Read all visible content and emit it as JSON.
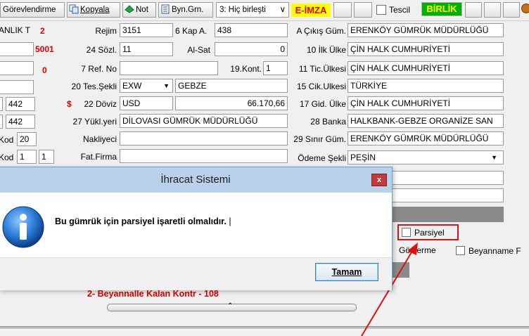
{
  "toolbar": {
    "gorevlendirme": "Görevlendirme",
    "kopyala": "Kopyala",
    "not": "Not",
    "byn_grn": "Byn.Grn.",
    "birlesti_select": "3: Hiç birleşti",
    "eimza": "E-İMZA",
    "tescil": "Tescil",
    "birlik": "BİRLİK"
  },
  "left_partial": {
    "r1": "ANLIK T",
    "r1_num": "2",
    "r2_num": "5001",
    "r3_num": "0",
    "r5_val": "442",
    "r6_val": "442",
    "r7_label": "Kod",
    "r7_val": "20",
    "r8_label": "Kod",
    "r8_val1": "1",
    "r8_val2": "1"
  },
  "form": {
    "rejim_label": "Rejim",
    "rejim": "3151",
    "kap_label": "6 Kap A.",
    "kap": "438",
    "sozl_label": "24 Sözl.",
    "sozl": "11",
    "alsat_label": "Al-Sat",
    "alsat": "0",
    "refno_label": "7 Ref. No",
    "refno": "",
    "kont_label": "19.Kont.",
    "kont": "1",
    "tesekli_label": "20 Tes.Şekli",
    "tesekli": "EXW",
    "tes_place": "GEBZE",
    "doviz_symbol": "$",
    "doviz_label": "22 Döviz",
    "doviz": "USD",
    "doviz_amount": "66.170,66",
    "yukl_label": "27 Yükl.yeri",
    "yukl": "DİLOVASI GÜMRÜK MÜDÜRLÜĞÜ",
    "nakliyeci_label": "Nakliyeci",
    "nakliyeci": "",
    "fatfirma_label": "Fat.Firma",
    "fatfirma": "",
    "cikis_label": "A Çıkış Güm.",
    "cikis": "ERENKÖY GÜMRÜK MÜDÜRLÜĞÜ",
    "ilkulke_label": "10 İlk Ülke",
    "ilkulke": "ÇİN HALK CUMHURİYETİ",
    "ticulke_label": "11 Tic.Ülkesi",
    "ticulke": "ÇİN HALK CUMHURİYETİ",
    "cikulke_label": "15 Cik.Ulkesi",
    "cikulke": "TÜRKİYE",
    "gidulke_label": "17 Gid. Ülke",
    "gidulke": "ÇİN HALK CUMHURİYETİ",
    "banka_label": "28 Banka",
    "banka": "HALKBANK-GEBZE ORGANİZE SAN",
    "sinir_label": "29 Sınır Güm.",
    "sinir": "ERENKÖY GÜMRÜK MÜDÜRLÜĞÜ",
    "odeme_label": "Ödeme Şekli",
    "odeme": "PEŞİN"
  },
  "options": {
    "parsiyel": "Parsiyel",
    "gosterme": "Gösterme",
    "beyanname": "Beyanname F"
  },
  "bottom_text": "2- Beyannalle Kalan Kontr - 108",
  "dialog": {
    "title": "İhracat Sistemi",
    "message": "Bu gümrük için parsiyel işaretli olmalıdır.",
    "ok_label": "Tamam",
    "close": "x"
  },
  "colors": {
    "annotation": "#e01010",
    "eimza_bg": "#ffff00",
    "eimza_fg": "#e00000",
    "birlik_bg": "#00b000",
    "title_bar": "#b9d1ea"
  }
}
